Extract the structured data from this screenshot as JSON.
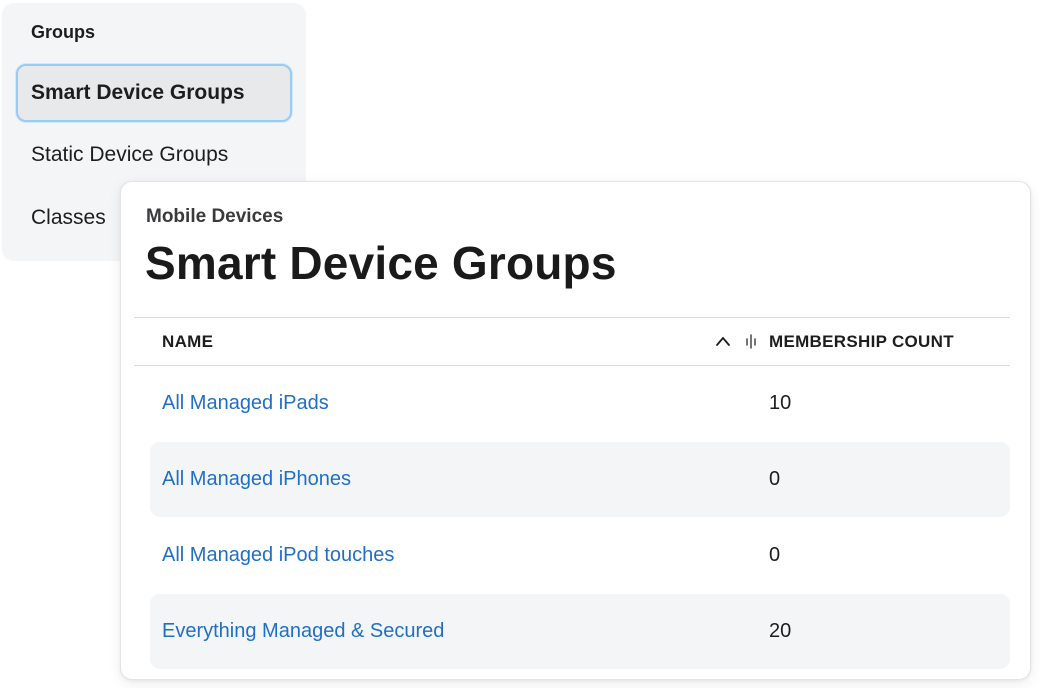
{
  "sidebar": {
    "heading": "Groups",
    "items": [
      {
        "label": "Smart Device Groups",
        "active": true
      },
      {
        "label": "Static Device Groups",
        "active": false
      },
      {
        "label": "Classes",
        "active": false
      }
    ]
  },
  "main": {
    "breadcrumb": "Mobile Devices",
    "title": "Smart Device Groups",
    "table": {
      "columns": {
        "name": "NAME",
        "count": "MEMBERSHIP COUNT"
      },
      "rows": [
        {
          "name": "All Managed iPads",
          "count": "10"
        },
        {
          "name": "All Managed iPhones",
          "count": "0"
        },
        {
          "name": "All Managed iPod touches",
          "count": "0"
        },
        {
          "name": "Everything Managed & Secured",
          "count": "20"
        }
      ]
    }
  },
  "icons": {
    "sort": "chevron-up-icon",
    "column_resize": "column-resize-icon"
  },
  "colors": {
    "link": "#1f6fc5",
    "active_border": "#9ccbf2",
    "panel_bg": "#f4f5f7",
    "text": "#1d1d1f"
  }
}
